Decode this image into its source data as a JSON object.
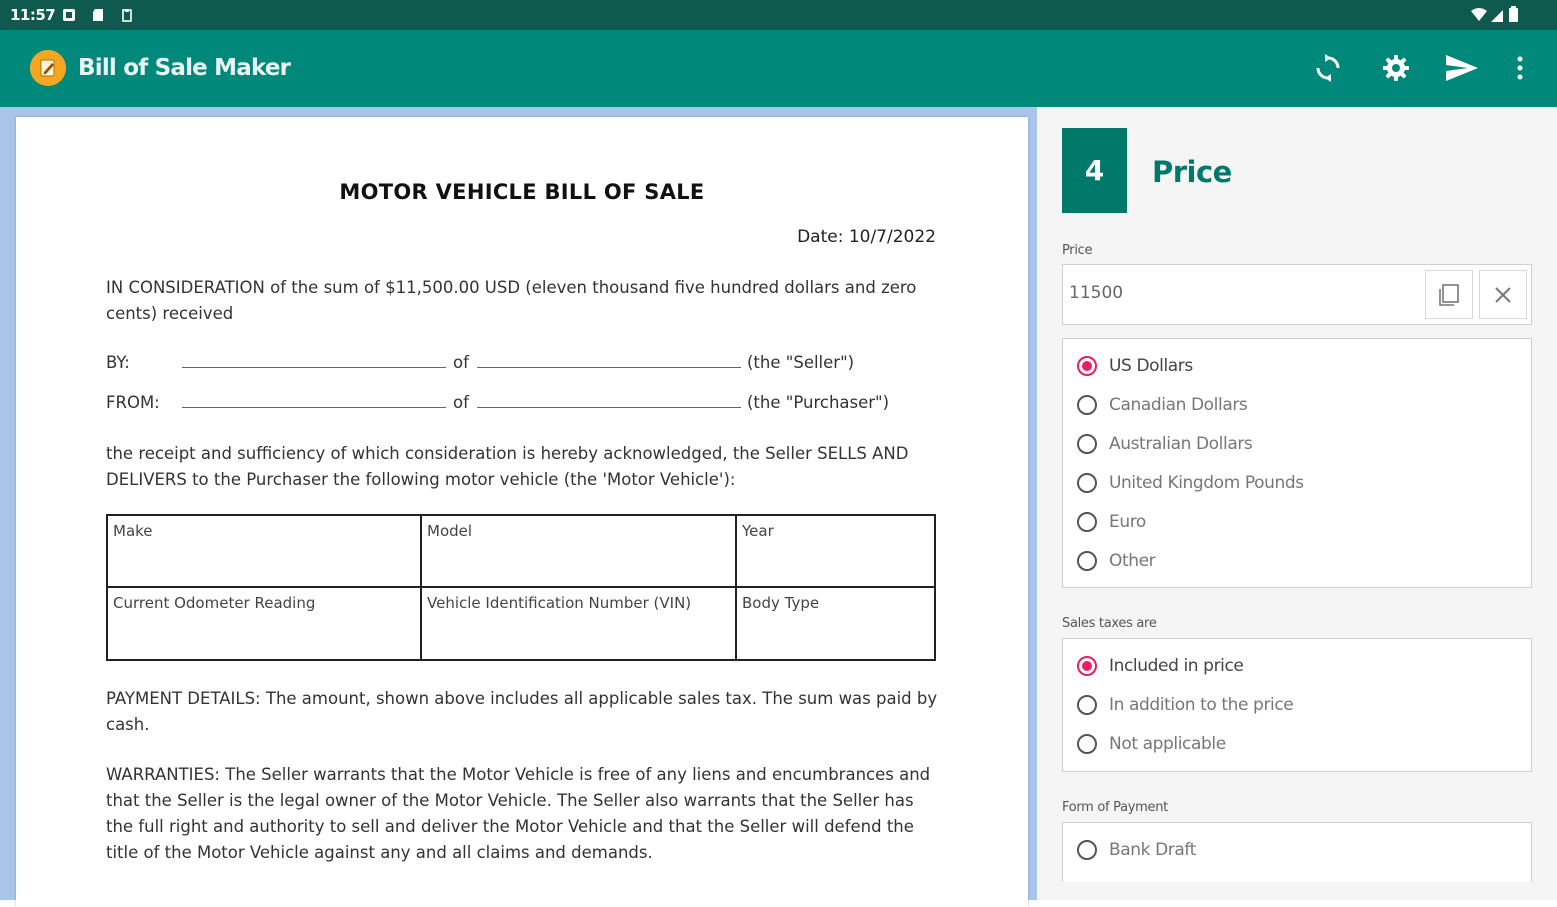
{
  "status_bar": {
    "time": "11:57"
  },
  "app_bar": {
    "title": "Bill of Sale Maker",
    "icons": [
      "refresh-icon",
      "gear-icon",
      "send-icon",
      "more-vert-icon"
    ],
    "color": "#00897b"
  },
  "document": {
    "title": "MOTOR VEHICLE BILL OF SALE",
    "date": "Date: 10/7/2022",
    "consideration": "IN CONSIDERATION of the sum of $11,500.00 USD (eleven thousand five hundred dollars and zero cents) received",
    "parties": [
      {
        "label": "BY:",
        "of": "of",
        "role": "(the \"Seller\")"
      },
      {
        "label": "FROM:",
        "of": "of",
        "role": "(the \"Purchaser\")"
      }
    ],
    "receipt": "the receipt and sufficiency of which consideration is hereby acknowledged, the Seller SELLS AND DELIVERS to the Purchaser the following motor vehicle (the 'Motor Vehicle'):",
    "vehicle_table": [
      [
        "Make",
        "Model",
        "Year"
      ],
      [
        "Current Odometer Reading",
        "Vehicle Identification Number (VIN)",
        "Body Type"
      ]
    ],
    "payment": "PAYMENT DETAILS: The amount, shown above includes all applicable sales tax. The sum was paid by cash.",
    "warranties": "WARRANTIES: The Seller warrants that the Motor Vehicle is free of any liens and encumbrances and that the Seller is the legal owner of the Motor Vehicle. The Seller also warrants that the Seller has the full right and authority to sell and deliver the Motor Vehicle and that the Seller will defend the title of the Motor Vehicle against any and all claims and demands."
  },
  "form": {
    "step_number": "4",
    "step_title": "Price",
    "price_label": "Price",
    "price_value": "11500",
    "currency_options": [
      {
        "label": "US Dollars",
        "checked": true
      },
      {
        "label": "Canadian Dollars",
        "checked": false
      },
      {
        "label": "Australian Dollars",
        "checked": false
      },
      {
        "label": "United Kingdom Pounds",
        "checked": false
      },
      {
        "label": "Euro",
        "checked": false
      },
      {
        "label": "Other",
        "checked": false
      }
    ],
    "sales_tax_label": "Sales taxes are",
    "sales_tax_options": [
      {
        "label": "Included in price",
        "checked": true
      },
      {
        "label": "In addition to the price",
        "checked": false
      },
      {
        "label": "Not applicable",
        "checked": false
      }
    ],
    "payment_label": "Form of Payment",
    "payment_options": [
      {
        "label": "Bank Draft",
        "checked": false
      }
    ],
    "accent_color": "#00796b",
    "radio_color": "#e91e63"
  }
}
